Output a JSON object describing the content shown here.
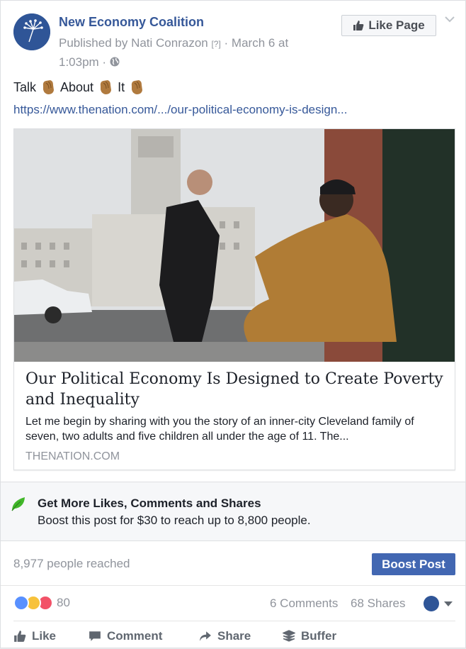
{
  "post": {
    "page_name": "New Economy Coalition",
    "meta_published": "Published by Nati Conrazon",
    "meta_help": "[?]",
    "meta_date": " · March 6 at 1:03pm · ",
    "like_page_label": "Like Page",
    "text_parts": [
      "Talk",
      "About",
      "It"
    ],
    "link": "https://www.thenation.com/.../our-political-economy-is-design..."
  },
  "preview": {
    "title": "Our Political Economy Is Designed to Create Poverty and Inequality",
    "description": "Let me begin by sharing with you the story of an inner-city Cleveland family of seven, two adults and five children all under the age of 11. The...",
    "domain": "THENATION.COM"
  },
  "boost": {
    "title": "Get More Likes, Comments and Shares",
    "description": "Boost this post for $30 to reach up to 8,800 people.",
    "reached": "8,977 people reached",
    "button_label": "Boost Post"
  },
  "stats": {
    "reaction_count": "80",
    "comments": "6 Comments",
    "shares": "68 Shares"
  },
  "actions": {
    "like": "Like",
    "comment": "Comment",
    "share": "Share",
    "buffer": "Buffer"
  },
  "colors": {
    "link": "#365899",
    "boost_button": "#4267b2",
    "muted": "#90949c"
  }
}
